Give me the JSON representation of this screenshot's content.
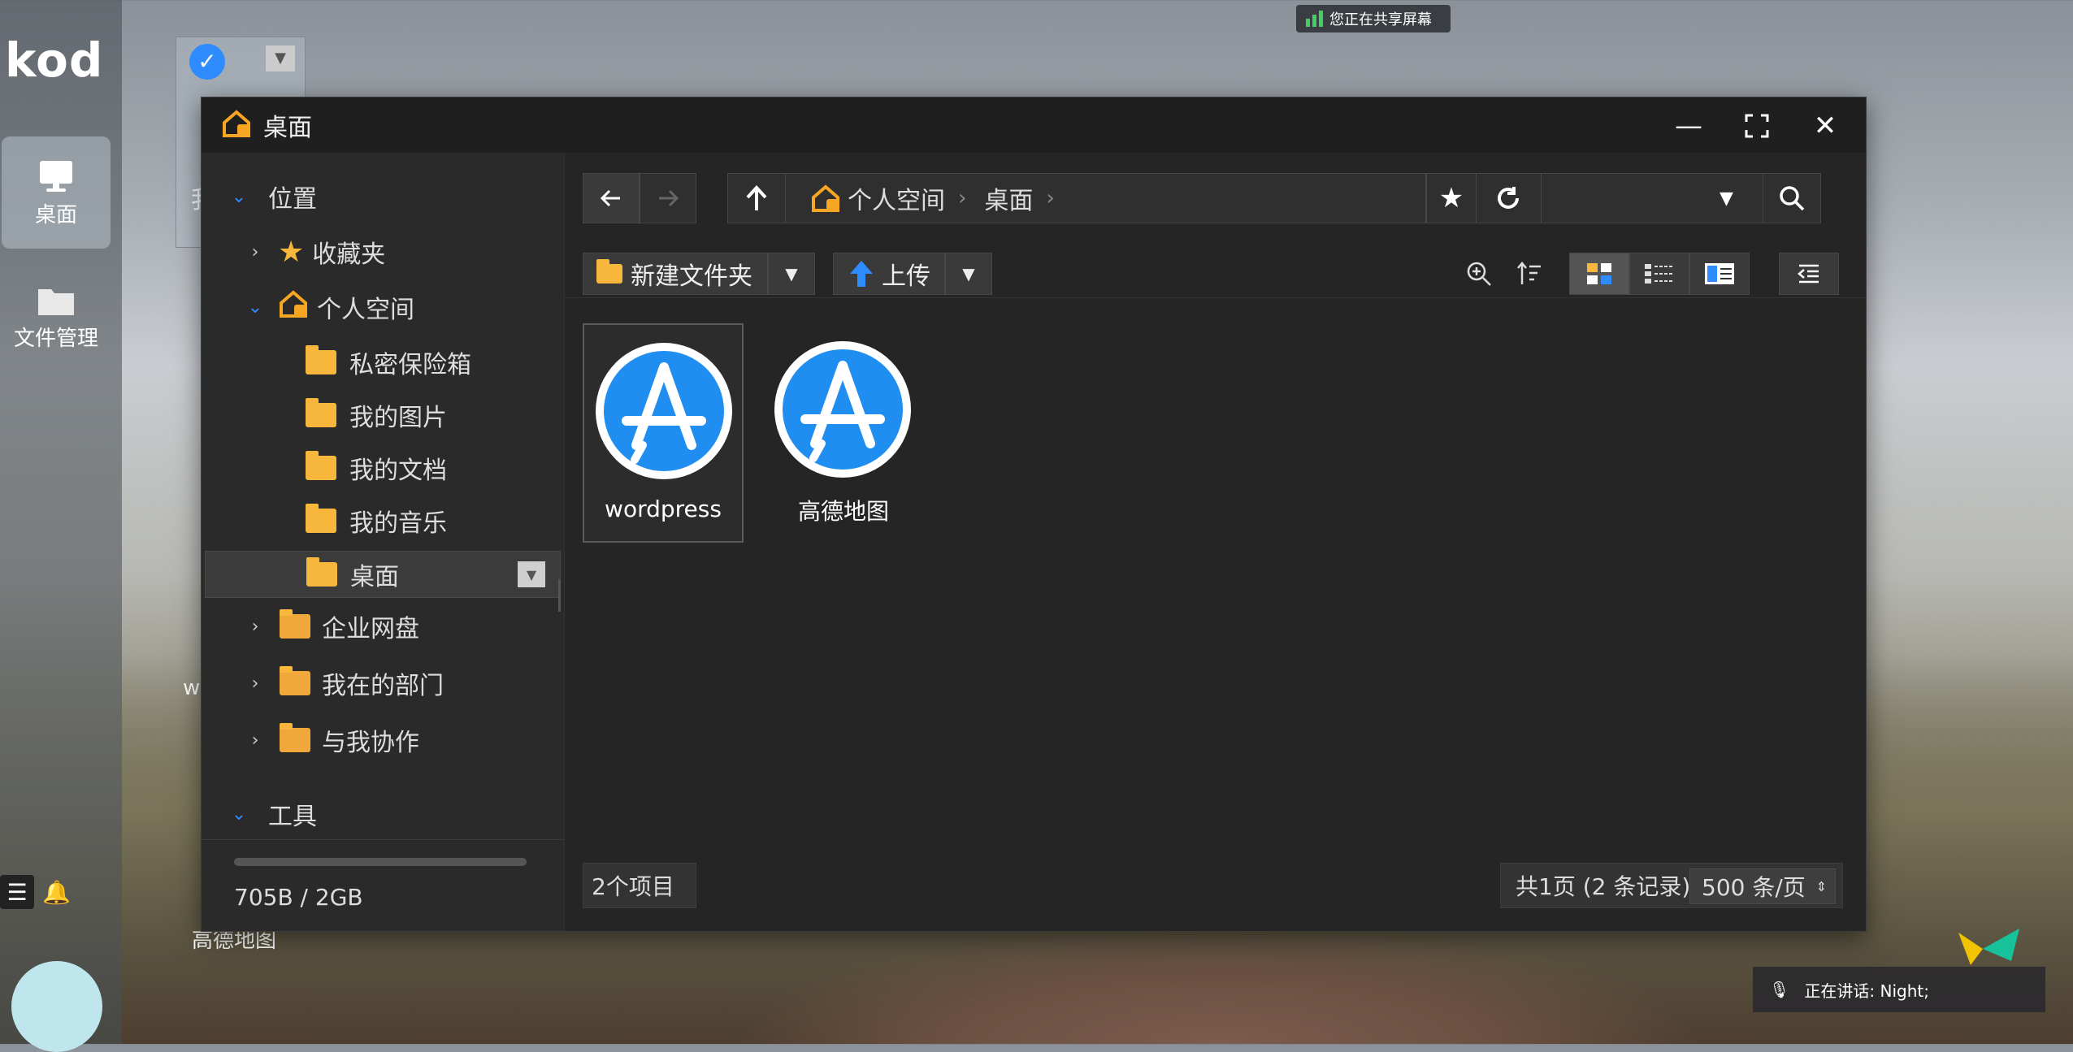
{
  "share_banner": "您正在共享屏幕",
  "dock": {
    "logo": "kod",
    "items": [
      {
        "label": "桌面",
        "icon": "monitor-icon"
      },
      {
        "label": "文件管理",
        "icon": "folder-icon"
      }
    ]
  },
  "desktop": {
    "icons": [
      {
        "label": "我"
      },
      {
        "label": "w"
      },
      {
        "label": "高德地图"
      }
    ]
  },
  "window": {
    "title": "桌面",
    "sidebar": {
      "location_header": "位置",
      "items": [
        {
          "label": "收藏夹"
        },
        {
          "label": "个人空间"
        },
        {
          "label": "私密保险箱"
        },
        {
          "label": "我的图片"
        },
        {
          "label": "我的文档"
        },
        {
          "label": "我的音乐"
        },
        {
          "label": "桌面"
        },
        {
          "label": "企业网盘"
        },
        {
          "label": "我在的部门"
        },
        {
          "label": "与我协作"
        }
      ],
      "tools_header": "工具",
      "quota": "705B / 2GB"
    },
    "breadcrumb": [
      "个人空间",
      "桌面"
    ],
    "toolbar": {
      "new_folder": "新建文件夹",
      "upload": "上传"
    },
    "files": [
      {
        "name": "wordpress",
        "icon": "app-store-icon"
      },
      {
        "name": "高德地图",
        "icon": "app-store-icon"
      }
    ],
    "status": {
      "count": "2个项目",
      "pages": "共1页 (2 条记录)",
      "per_page": "500 条/页"
    }
  },
  "speaking": "正在讲话: Night;",
  "colors": {
    "accent": "#2f8cff",
    "folder": "#f6b73c",
    "window_bg": "#252526"
  }
}
